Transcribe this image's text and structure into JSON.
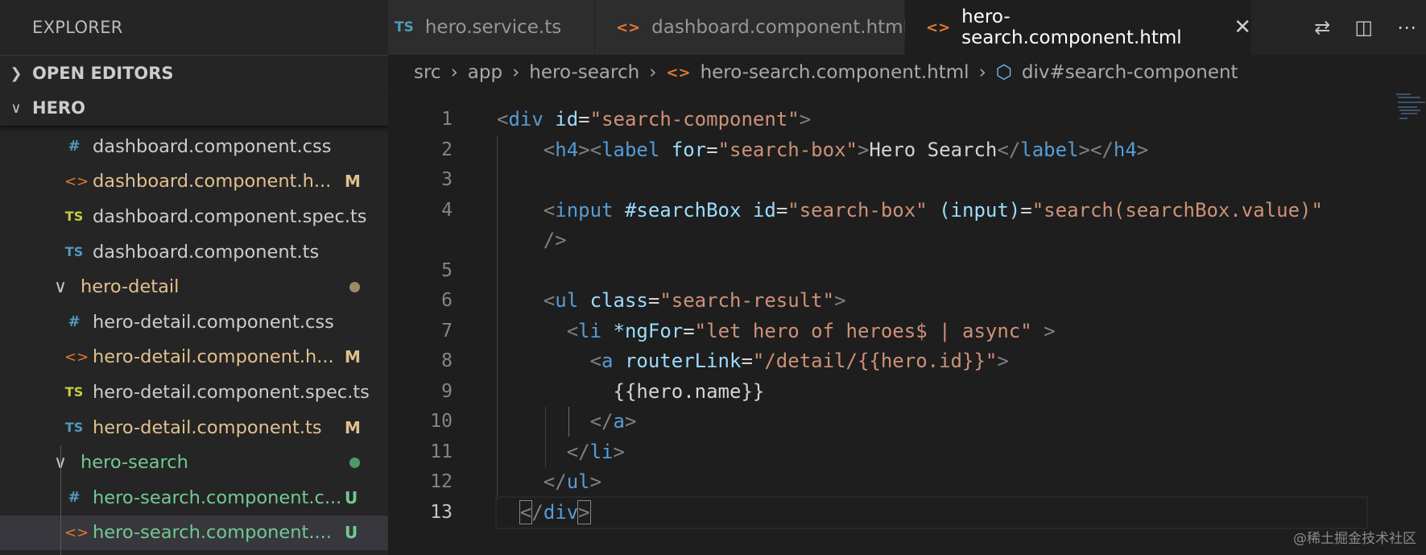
{
  "sidebar": {
    "title": "EXPLORER",
    "sections": [
      {
        "label": "OPEN EDITORS",
        "expanded": false
      },
      {
        "label": "HERO",
        "expanded": true
      }
    ],
    "tree": [
      {
        "type": "file",
        "icon": "#",
        "icon_kind": "css-icon",
        "label": "dashboard.component.css",
        "status": "",
        "color": "plain"
      },
      {
        "type": "file",
        "icon": "<>",
        "icon_kind": "html-icon",
        "label": "dashboard.component.h...",
        "status": "M",
        "color": "mod"
      },
      {
        "type": "file",
        "icon": "TS",
        "icon_kind": "ts-spec-icon",
        "label": "dashboard.component.spec.ts",
        "status": "",
        "color": "plain"
      },
      {
        "type": "file",
        "icon": "TS",
        "icon_kind": "ts-icon",
        "label": "dashboard.component.ts",
        "status": "",
        "color": "plain"
      },
      {
        "type": "folder",
        "label": "hero-detail",
        "dot": "#9c8a6a",
        "color": "mod"
      },
      {
        "type": "file",
        "icon": "#",
        "icon_kind": "css-icon",
        "label": "hero-detail.component.css",
        "status": "",
        "color": "plain"
      },
      {
        "type": "file",
        "icon": "<>",
        "icon_kind": "html-icon",
        "label": "hero-detail.component.h...",
        "status": "M",
        "color": "mod"
      },
      {
        "type": "file",
        "icon": "TS",
        "icon_kind": "ts-spec-icon",
        "label": "hero-detail.component.spec.ts",
        "status": "",
        "color": "plain"
      },
      {
        "type": "file",
        "icon": "TS",
        "icon_kind": "ts-icon",
        "label": "hero-detail.component.ts",
        "status": "M",
        "color": "mod"
      },
      {
        "type": "folder",
        "label": "hero-search",
        "dot": "#4a9a63",
        "color": "untracked"
      },
      {
        "type": "file",
        "icon": "#",
        "icon_kind": "css-icon",
        "label": "hero-search.component.c...",
        "status": "U",
        "color": "untracked"
      },
      {
        "type": "file",
        "icon": "<>",
        "icon_kind": "html-icon",
        "label": "hero-search.component....",
        "status": "U",
        "color": "untracked",
        "selected": true
      }
    ]
  },
  "tabs": [
    {
      "icon": "TS",
      "label": "hero.service.ts",
      "active": false
    },
    {
      "icon": "<>",
      "label": "dashboard.component.html",
      "active": false
    },
    {
      "icon": "<>",
      "label": "hero-search.component.html",
      "active": true
    }
  ],
  "breadcrumb": {
    "parts": [
      "src",
      "app",
      "hero-search"
    ],
    "file": "hero-search.component.html",
    "symbol": "div#search-component"
  },
  "editor": {
    "line_numbers": [
      "1",
      "2",
      "3",
      "4",
      "",
      "5",
      "6",
      "7",
      "8",
      "9",
      "10",
      "11",
      "12",
      "13"
    ],
    "current_line": "13"
  },
  "watermark": "@稀土掘金技术社区",
  "colors": {
    "accent": "#569cd6",
    "modified": "#e2c08d",
    "untracked": "#73c991",
    "background": "#1e1e1e"
  }
}
